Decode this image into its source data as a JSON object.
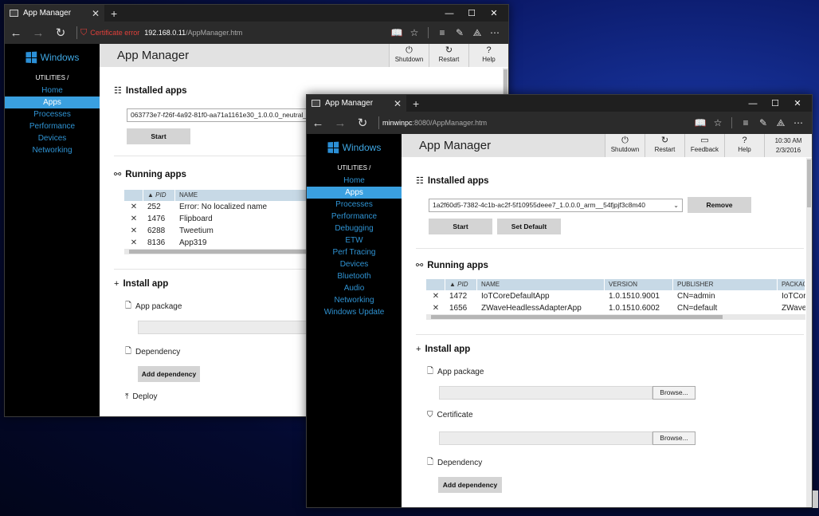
{
  "colors": {
    "accent": "#3aa0e0",
    "nav_text": "#2f93d3",
    "cert_error": "#e0403a",
    "table_header": "#c7d9e6"
  },
  "window1": {
    "tab_title": "App Manager",
    "cert_error": "Certificate error",
    "url_host": "192.168.0.11",
    "url_path": "/AppManager.htm",
    "sidebar": {
      "logo": "Windows",
      "utilities_label": "UTILITIES /",
      "items": [
        "Home",
        "Apps",
        "Processes",
        "Performance",
        "Devices",
        "Networking"
      ],
      "active": "Apps"
    },
    "page_title": "App Manager",
    "header_buttons": [
      "Shutdown",
      "Restart",
      "Help"
    ],
    "installed_apps": {
      "title": "Installed apps",
      "selected": "063773e7-f26f-4a92-81f0-aa71a1161e30_1.0.0.0_neutral__",
      "start_label": "Start"
    },
    "running_apps": {
      "title": "Running apps",
      "columns": [
        "PID",
        "NAME"
      ],
      "rows": [
        {
          "pid": "252",
          "name": "Error: No localized name"
        },
        {
          "pid": "1476",
          "name": "Flipboard"
        },
        {
          "pid": "6288",
          "name": "Tweetium"
        },
        {
          "pid": "8136",
          "name": "App319"
        }
      ]
    },
    "install_app": {
      "title": "Install app",
      "app_package_label": "App package",
      "dependency_label": "Dependency",
      "add_dependency_label": "Add dependency",
      "deploy_label": "Deploy"
    }
  },
  "window2": {
    "tab_title": "App Manager",
    "url_host": "minwinpc",
    "url_port": ":8080",
    "url_path": "/AppManager.htm",
    "sidebar": {
      "logo": "Windows",
      "utilities_label": "UTILITIES /",
      "items": [
        "Home",
        "Apps",
        "Processes",
        "Performance",
        "Debugging",
        "ETW",
        "Perf Tracing",
        "Devices",
        "Bluetooth",
        "Audio",
        "Networking",
        "Windows Update"
      ],
      "active": "Apps"
    },
    "page_title": "App Manager",
    "header_buttons": [
      "Shutdown",
      "Restart",
      "Feedback",
      "Help"
    ],
    "clock": {
      "time": "10:30 AM",
      "date": "2/3/2016"
    },
    "installed_apps": {
      "title": "Installed apps",
      "selected": "1a2f60d5-7382-4c1b-ac2f-5f10955deee7_1.0.0.0_arm__54fjpjf3c8m40",
      "remove_label": "Remove",
      "start_label": "Start",
      "set_default_label": "Set Default"
    },
    "running_apps": {
      "title": "Running apps",
      "columns": [
        "PID",
        "NAME",
        "VERSION",
        "PUBLISHER",
        "PACKAG"
      ],
      "rows": [
        {
          "pid": "1472",
          "name": "IoTCoreDefaultApp",
          "version": "1.0.1510.9001",
          "publisher": "CN=admin",
          "package": "IoTCor"
        },
        {
          "pid": "1656",
          "name": "ZWaveHeadlessAdapterApp",
          "version": "1.0.1510.6002",
          "publisher": "CN=default",
          "package": "ZWave"
        }
      ]
    },
    "install_app": {
      "title": "Install app",
      "app_package_label": "App package",
      "certificate_label": "Certificate",
      "dependency_label": "Dependency",
      "browse_label": "Browse...",
      "add_dependency_label": "Add dependency"
    }
  }
}
